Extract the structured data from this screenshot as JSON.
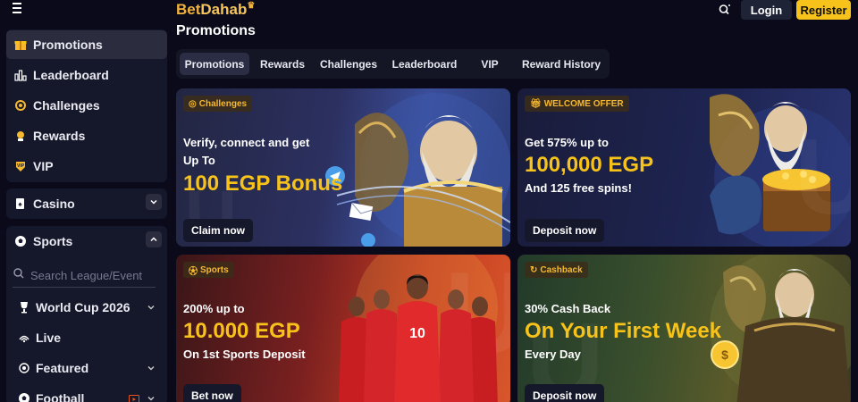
{
  "header": {
    "logo_part1": "Bet",
    "logo_part2": "Dahab",
    "login_label": "Login",
    "register_label": "Register"
  },
  "sidebar": {
    "items": [
      {
        "label": "Promotions",
        "icon": "gift-icon"
      },
      {
        "label": "Leaderboard",
        "icon": "leaderboard-icon"
      },
      {
        "label": "Challenges",
        "icon": "target-icon"
      },
      {
        "label": "Rewards",
        "icon": "rewards-icon"
      },
      {
        "label": "VIP",
        "icon": "vip-icon"
      }
    ],
    "casino_label": "Casino",
    "sports_label": "Sports",
    "search_placeholder": "Search League/Event",
    "sports_items": [
      {
        "label": "World Cup 2026",
        "icon": "trophy-icon"
      },
      {
        "label": "Live",
        "icon": "live-icon"
      },
      {
        "label": "Featured",
        "icon": "star-icon"
      },
      {
        "label": "Football",
        "icon": "football-icon"
      }
    ]
  },
  "main": {
    "title": "Promotions",
    "tabs": [
      "Promotions",
      "Rewards",
      "Challenges",
      "Leaderboard",
      "VIP",
      "Reward History"
    ],
    "active_tab": "Promotions",
    "cards": [
      {
        "badge": "Challenges",
        "line1": "Verify, connect and get",
        "line2": "Up To",
        "big": "100 EGP Bonus",
        "line3": "",
        "cta": "Claim now"
      },
      {
        "badge": "WELCOME OFFER",
        "line1": "Get 575% up to",
        "line2": "",
        "big": "100,000 EGP",
        "line3": "And 125 free spins!",
        "cta": "Deposit now"
      },
      {
        "badge": "Sports",
        "line1": "200% up to",
        "line2": "",
        "big": "10.000 EGP",
        "line3": "On 1st Sports Deposit",
        "cta": "Bet now"
      },
      {
        "badge": "Cashback",
        "line1": "30% Cash Back",
        "line2": "",
        "big": "On Your First Week",
        "line3": "Every Day",
        "cta": "Deposit now"
      }
    ]
  },
  "colors": {
    "accent": "#f7c31a",
    "background": "#0a0a1a",
    "panel": "#15172a"
  }
}
